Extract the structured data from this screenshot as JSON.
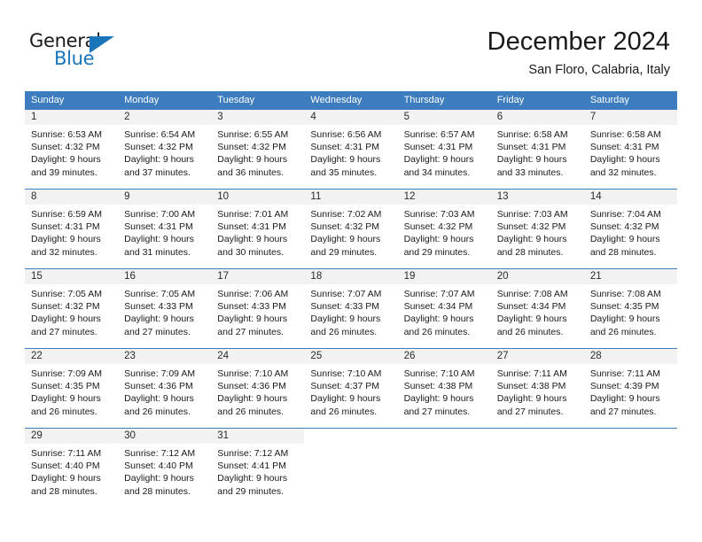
{
  "brand": {
    "name_top": "General",
    "name_bottom": "Blue",
    "accent_color": "#1b75bb"
  },
  "header": {
    "title": "December 2024",
    "location": "San Floro, Calabria, Italy"
  },
  "calendar": {
    "header_background": "#3d7dbf",
    "daynum_background": "#f2f2f2",
    "weekdays": [
      "Sunday",
      "Monday",
      "Tuesday",
      "Wednesday",
      "Thursday",
      "Friday",
      "Saturday"
    ],
    "weeks": [
      [
        {
          "day": "1",
          "sunrise": "Sunrise: 6:53 AM",
          "sunset": "Sunset: 4:32 PM",
          "daylight1": "Daylight: 9 hours",
          "daylight2": "and 39 minutes."
        },
        {
          "day": "2",
          "sunrise": "Sunrise: 6:54 AM",
          "sunset": "Sunset: 4:32 PM",
          "daylight1": "Daylight: 9 hours",
          "daylight2": "and 37 minutes."
        },
        {
          "day": "3",
          "sunrise": "Sunrise: 6:55 AM",
          "sunset": "Sunset: 4:32 PM",
          "daylight1": "Daylight: 9 hours",
          "daylight2": "and 36 minutes."
        },
        {
          "day": "4",
          "sunrise": "Sunrise: 6:56 AM",
          "sunset": "Sunset: 4:31 PM",
          "daylight1": "Daylight: 9 hours",
          "daylight2": "and 35 minutes."
        },
        {
          "day": "5",
          "sunrise": "Sunrise: 6:57 AM",
          "sunset": "Sunset: 4:31 PM",
          "daylight1": "Daylight: 9 hours",
          "daylight2": "and 34 minutes."
        },
        {
          "day": "6",
          "sunrise": "Sunrise: 6:58 AM",
          "sunset": "Sunset: 4:31 PM",
          "daylight1": "Daylight: 9 hours",
          "daylight2": "and 33 minutes."
        },
        {
          "day": "7",
          "sunrise": "Sunrise: 6:58 AM",
          "sunset": "Sunset: 4:31 PM",
          "daylight1": "Daylight: 9 hours",
          "daylight2": "and 32 minutes."
        }
      ],
      [
        {
          "day": "8",
          "sunrise": "Sunrise: 6:59 AM",
          "sunset": "Sunset: 4:31 PM",
          "daylight1": "Daylight: 9 hours",
          "daylight2": "and 32 minutes."
        },
        {
          "day": "9",
          "sunrise": "Sunrise: 7:00 AM",
          "sunset": "Sunset: 4:31 PM",
          "daylight1": "Daylight: 9 hours",
          "daylight2": "and 31 minutes."
        },
        {
          "day": "10",
          "sunrise": "Sunrise: 7:01 AM",
          "sunset": "Sunset: 4:31 PM",
          "daylight1": "Daylight: 9 hours",
          "daylight2": "and 30 minutes."
        },
        {
          "day": "11",
          "sunrise": "Sunrise: 7:02 AM",
          "sunset": "Sunset: 4:32 PM",
          "daylight1": "Daylight: 9 hours",
          "daylight2": "and 29 minutes."
        },
        {
          "day": "12",
          "sunrise": "Sunrise: 7:03 AM",
          "sunset": "Sunset: 4:32 PM",
          "daylight1": "Daylight: 9 hours",
          "daylight2": "and 29 minutes."
        },
        {
          "day": "13",
          "sunrise": "Sunrise: 7:03 AM",
          "sunset": "Sunset: 4:32 PM",
          "daylight1": "Daylight: 9 hours",
          "daylight2": "and 28 minutes."
        },
        {
          "day": "14",
          "sunrise": "Sunrise: 7:04 AM",
          "sunset": "Sunset: 4:32 PM",
          "daylight1": "Daylight: 9 hours",
          "daylight2": "and 28 minutes."
        }
      ],
      [
        {
          "day": "15",
          "sunrise": "Sunrise: 7:05 AM",
          "sunset": "Sunset: 4:32 PM",
          "daylight1": "Daylight: 9 hours",
          "daylight2": "and 27 minutes."
        },
        {
          "day": "16",
          "sunrise": "Sunrise: 7:05 AM",
          "sunset": "Sunset: 4:33 PM",
          "daylight1": "Daylight: 9 hours",
          "daylight2": "and 27 minutes."
        },
        {
          "day": "17",
          "sunrise": "Sunrise: 7:06 AM",
          "sunset": "Sunset: 4:33 PM",
          "daylight1": "Daylight: 9 hours",
          "daylight2": "and 27 minutes."
        },
        {
          "day": "18",
          "sunrise": "Sunrise: 7:07 AM",
          "sunset": "Sunset: 4:33 PM",
          "daylight1": "Daylight: 9 hours",
          "daylight2": "and 26 minutes."
        },
        {
          "day": "19",
          "sunrise": "Sunrise: 7:07 AM",
          "sunset": "Sunset: 4:34 PM",
          "daylight1": "Daylight: 9 hours",
          "daylight2": "and 26 minutes."
        },
        {
          "day": "20",
          "sunrise": "Sunrise: 7:08 AM",
          "sunset": "Sunset: 4:34 PM",
          "daylight1": "Daylight: 9 hours",
          "daylight2": "and 26 minutes."
        },
        {
          "day": "21",
          "sunrise": "Sunrise: 7:08 AM",
          "sunset": "Sunset: 4:35 PM",
          "daylight1": "Daylight: 9 hours",
          "daylight2": "and 26 minutes."
        }
      ],
      [
        {
          "day": "22",
          "sunrise": "Sunrise: 7:09 AM",
          "sunset": "Sunset: 4:35 PM",
          "daylight1": "Daylight: 9 hours",
          "daylight2": "and 26 minutes."
        },
        {
          "day": "23",
          "sunrise": "Sunrise: 7:09 AM",
          "sunset": "Sunset: 4:36 PM",
          "daylight1": "Daylight: 9 hours",
          "daylight2": "and 26 minutes."
        },
        {
          "day": "24",
          "sunrise": "Sunrise: 7:10 AM",
          "sunset": "Sunset: 4:36 PM",
          "daylight1": "Daylight: 9 hours",
          "daylight2": "and 26 minutes."
        },
        {
          "day": "25",
          "sunrise": "Sunrise: 7:10 AM",
          "sunset": "Sunset: 4:37 PM",
          "daylight1": "Daylight: 9 hours",
          "daylight2": "and 26 minutes."
        },
        {
          "day": "26",
          "sunrise": "Sunrise: 7:10 AM",
          "sunset": "Sunset: 4:38 PM",
          "daylight1": "Daylight: 9 hours",
          "daylight2": "and 27 minutes."
        },
        {
          "day": "27",
          "sunrise": "Sunrise: 7:11 AM",
          "sunset": "Sunset: 4:38 PM",
          "daylight1": "Daylight: 9 hours",
          "daylight2": "and 27 minutes."
        },
        {
          "day": "28",
          "sunrise": "Sunrise: 7:11 AM",
          "sunset": "Sunset: 4:39 PM",
          "daylight1": "Daylight: 9 hours",
          "daylight2": "and 27 minutes."
        }
      ],
      [
        {
          "day": "29",
          "sunrise": "Sunrise: 7:11 AM",
          "sunset": "Sunset: 4:40 PM",
          "daylight1": "Daylight: 9 hours",
          "daylight2": "and 28 minutes."
        },
        {
          "day": "30",
          "sunrise": "Sunrise: 7:12 AM",
          "sunset": "Sunset: 4:40 PM",
          "daylight1": "Daylight: 9 hours",
          "daylight2": "and 28 minutes."
        },
        {
          "day": "31",
          "sunrise": "Sunrise: 7:12 AM",
          "sunset": "Sunset: 4:41 PM",
          "daylight1": "Daylight: 9 hours",
          "daylight2": "and 29 minutes."
        },
        {
          "day": "",
          "sunrise": "",
          "sunset": "",
          "daylight1": "",
          "daylight2": ""
        },
        {
          "day": "",
          "sunrise": "",
          "sunset": "",
          "daylight1": "",
          "daylight2": ""
        },
        {
          "day": "",
          "sunrise": "",
          "sunset": "",
          "daylight1": "",
          "daylight2": ""
        },
        {
          "day": "",
          "sunrise": "",
          "sunset": "",
          "daylight1": "",
          "daylight2": ""
        }
      ]
    ]
  }
}
